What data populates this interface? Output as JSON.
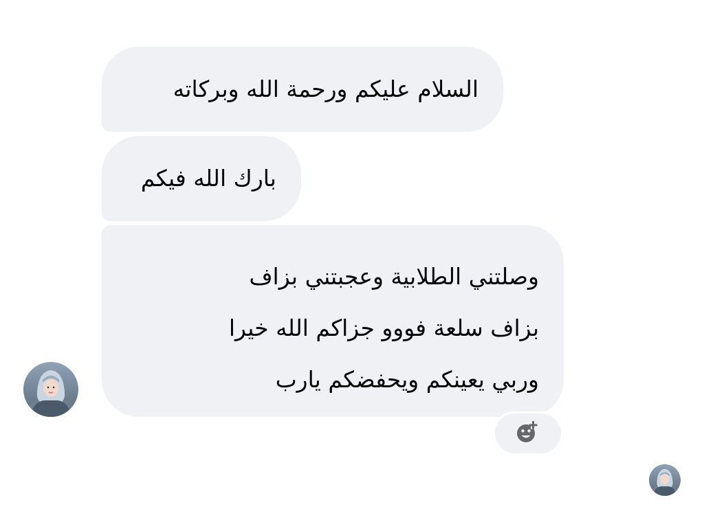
{
  "messages": [
    {
      "text": "السلام عليكم ورحمة الله وبركاته"
    },
    {
      "text": "بارك الله فيكم"
    },
    {
      "text": "وصلتني الطلابية وعجبتني بزاف\nبزاف سلعة فووو جزاكم الله خيرا\nوربي يعينكم ويحفضكم يارب"
    }
  ],
  "reaction": {
    "icon": "add-reaction-icon"
  },
  "sender": {
    "avatar_icon": "sender-avatar"
  },
  "seen": {
    "avatar_icon": "seen-receipt-avatar"
  },
  "colors": {
    "bubble": "#f0f1f4",
    "text": "#050505",
    "icon": "#65676b",
    "background": "#ffffff"
  }
}
